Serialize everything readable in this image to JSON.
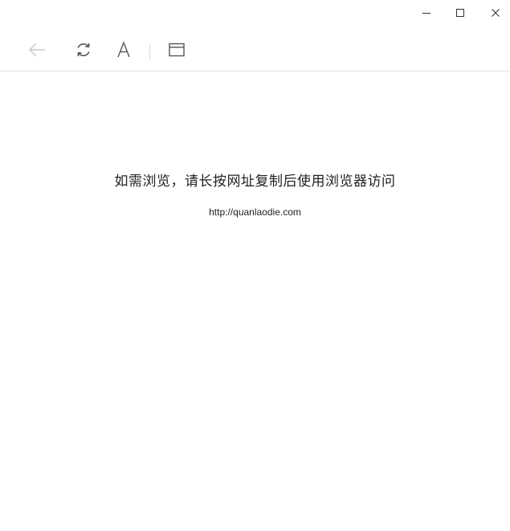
{
  "window": {
    "controls": {
      "minimize_icon": "minimize-icon",
      "maximize_icon": "maximize-icon",
      "close_icon": "close-icon"
    }
  },
  "toolbar": {
    "items": [
      {
        "name": "back",
        "icon": "arrow-left-icon",
        "enabled": false
      },
      {
        "name": "refresh",
        "icon": "refresh-icon",
        "enabled": true
      },
      {
        "name": "font",
        "icon": "font-size-icon",
        "label": "A",
        "enabled": true
      },
      {
        "name": "open-in-browser",
        "icon": "window-icon",
        "enabled": true
      }
    ]
  },
  "page": {
    "message": "如需浏览，请长按网址复制后使用浏览器访问",
    "url": "http://quanlaodie.com"
  },
  "colors": {
    "background": "#ffffff",
    "icon": "#555555",
    "icon_disabled": "#c8c8c8",
    "text": "#222222",
    "divider": "#e6e6e6"
  }
}
